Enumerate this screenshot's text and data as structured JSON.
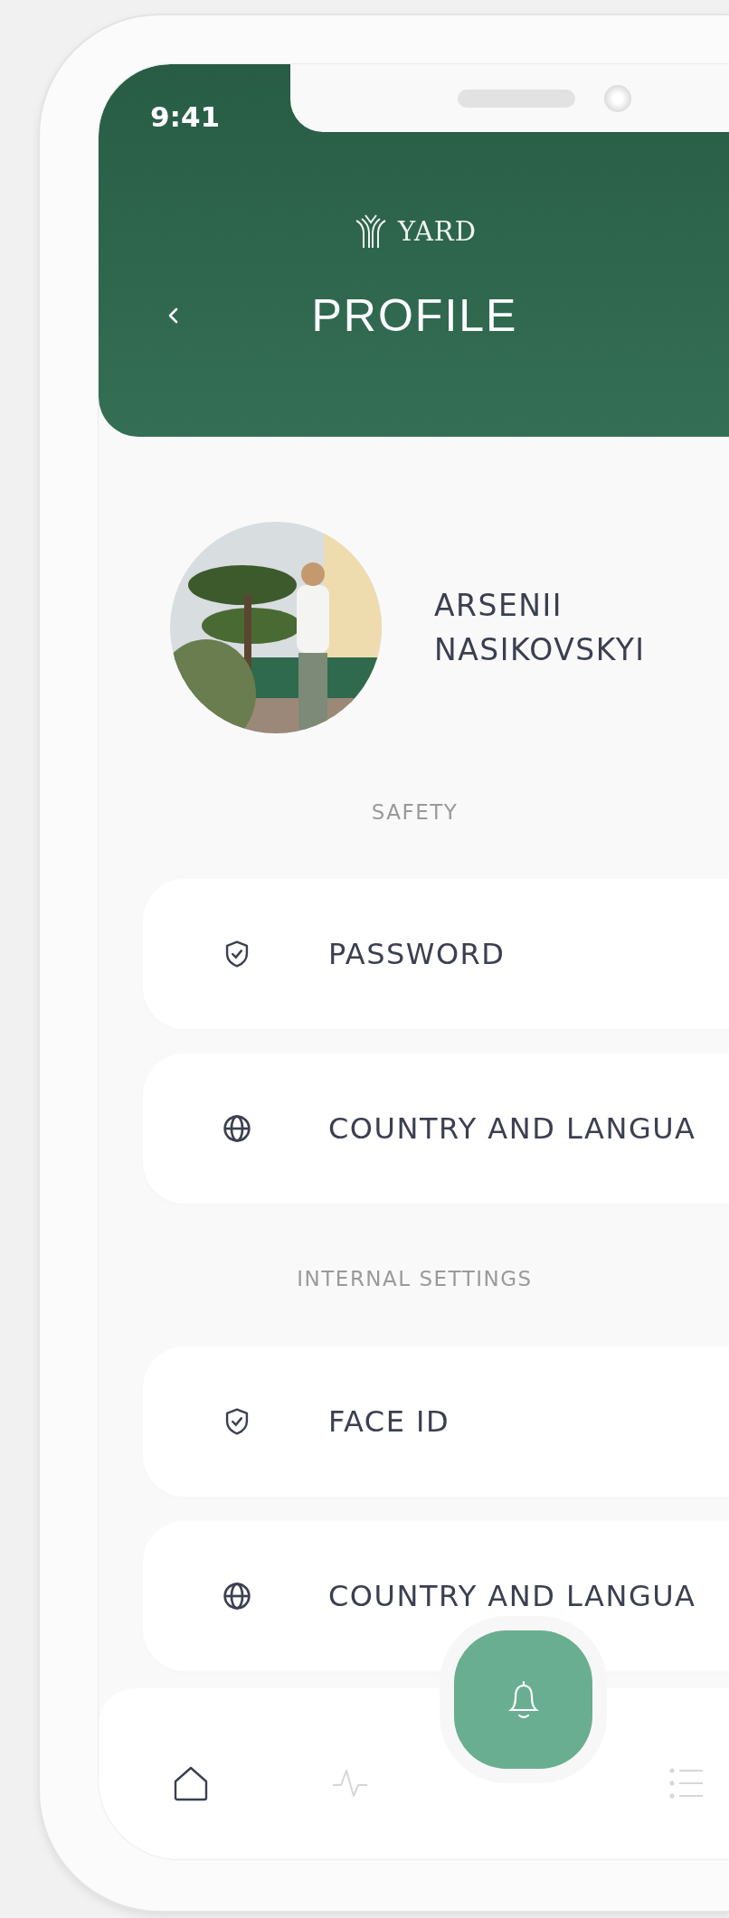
{
  "status_bar": {
    "time": "9:41"
  },
  "header": {
    "logo_text": "YARD",
    "title": "PROFILE"
  },
  "profile": {
    "name": "ARSENII NASIKOVSKYI"
  },
  "sections": [
    {
      "title": "SAFETY",
      "items": [
        {
          "kind": "shield",
          "label": "PASSWORD"
        },
        {
          "kind": "globe",
          "label": "COUNTRY AND LANGUA"
        }
      ]
    },
    {
      "title": "INTERNAL SETTINGS",
      "items": [
        {
          "kind": "shield",
          "label": "FACE ID"
        },
        {
          "kind": "globe",
          "label": "COUNTRY AND LANGUA"
        }
      ]
    }
  ],
  "bottom_nav": {
    "items": [
      {
        "kind": "home",
        "selected": true
      },
      {
        "kind": "pulse",
        "selected": false
      },
      {
        "kind": "bell",
        "selected": false
      },
      {
        "kind": "list",
        "selected": false
      }
    ]
  }
}
